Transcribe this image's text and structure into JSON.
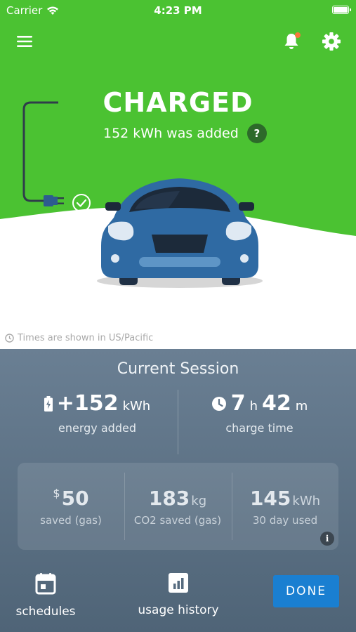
{
  "status_bar": {
    "carrier": "Carrier",
    "time": "4:23 PM"
  },
  "colors": {
    "accent_green": "#4bc232",
    "panel": "#5a6e82",
    "done_button": "#1a7fd1"
  },
  "header": {
    "menu_icon": "hamburger-menu-icon",
    "bell_icon": "bell-icon",
    "settings_icon": "gear-icon"
  },
  "charge_status": {
    "title": "CHARGED",
    "added_text": "152 kWh was added",
    "help_label": "?"
  },
  "timezone_note": "Times are shown in US/Pacific",
  "session": {
    "title": "Current Session",
    "energy": {
      "value": "+152",
      "unit": "kWh",
      "label": "energy added"
    },
    "charge_time": {
      "hours": "7",
      "hours_unit": "h",
      "minutes": "42",
      "minutes_unit": "m",
      "label": "charge time"
    }
  },
  "savings": {
    "money": {
      "currency": "$",
      "value": "50",
      "label": "saved (gas)"
    },
    "co2": {
      "value": "183",
      "unit": "kg",
      "label": "CO2 saved (gas)"
    },
    "usage": {
      "value": "145",
      "unit": "kWh",
      "label": "30 day used"
    },
    "info_label": "i"
  },
  "bottom_nav": {
    "schedules": "schedules",
    "usage_history": "usage history",
    "done": "DONE"
  }
}
